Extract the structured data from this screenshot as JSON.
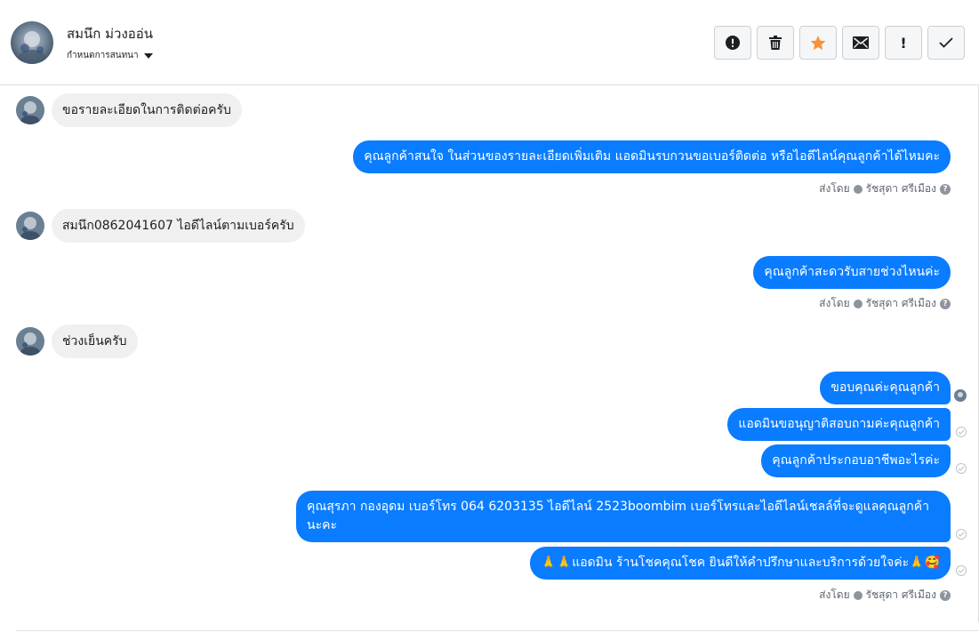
{
  "header": {
    "contact_name": "สมนึก ม่วงออ่น",
    "conversation_action": "กำหนดการสนทนา"
  },
  "toolbar": [
    {
      "name": "mark-spam-button",
      "icon": "alert-circle-icon"
    },
    {
      "name": "delete-button",
      "icon": "trash-icon"
    },
    {
      "name": "star-button",
      "icon": "star-icon",
      "color": "#f7923b"
    },
    {
      "name": "mark-unread-button",
      "icon": "envelope-icon"
    },
    {
      "name": "follow-up-button",
      "icon": "exclamation-icon",
      "label": "!"
    },
    {
      "name": "mark-done-button",
      "icon": "checkmark-icon"
    }
  ],
  "messages": {
    "in_1": "ขอรายละเอียดในการติดต่อครับ",
    "out_1": "คุณลูกค้าสนใจ ในส่วนของรายละเอียดเพิ่มเติม แอดมินรบกวนขอเบอร์ติดต่อ หรือไอดีไลน์คุณลูกค้าได้ไหมคะ",
    "in_2": "สมนึก0862041607  ไอดีไลน์ตามเบอร์ครับ",
    "out_2": "คุณลูกค้าสะดวรับสายช่วงไหนค่ะ",
    "in_3": "ช่วงเย็นครับ",
    "out_3a": "ขอบคุณค่ะคุณลูกค้า",
    "out_3b": "แอดมินขอนุญาติสอบถามค่ะคุณลูกค้า",
    "out_3c": "คุณลูกค้าประกอบอาชีพอะไรค่ะ",
    "out_4a": "คุณสุรภา กองอุดม  เบอร์โทร 064 6203135 ไอดีไลน์ 2523boombim   เบอร์โทรและไอดีไลน์เชลล์ที่จะดูแลคุณลูกค้านะคะ",
    "out_4b": "🙏🙏แอดมิน ร้านโชคคุณโชค ยินดีให้คำปรึกษาและบริการด้วยใจค่ะ🙏🥰"
  },
  "sent_by": {
    "prefix": "ส่งโดย",
    "agent": "รัชสุดา ศรีเมือง",
    "help": "?"
  },
  "colors": {
    "outgoing_bubble": "#0a7cff",
    "incoming_bubble": "#f0f0f0"
  }
}
